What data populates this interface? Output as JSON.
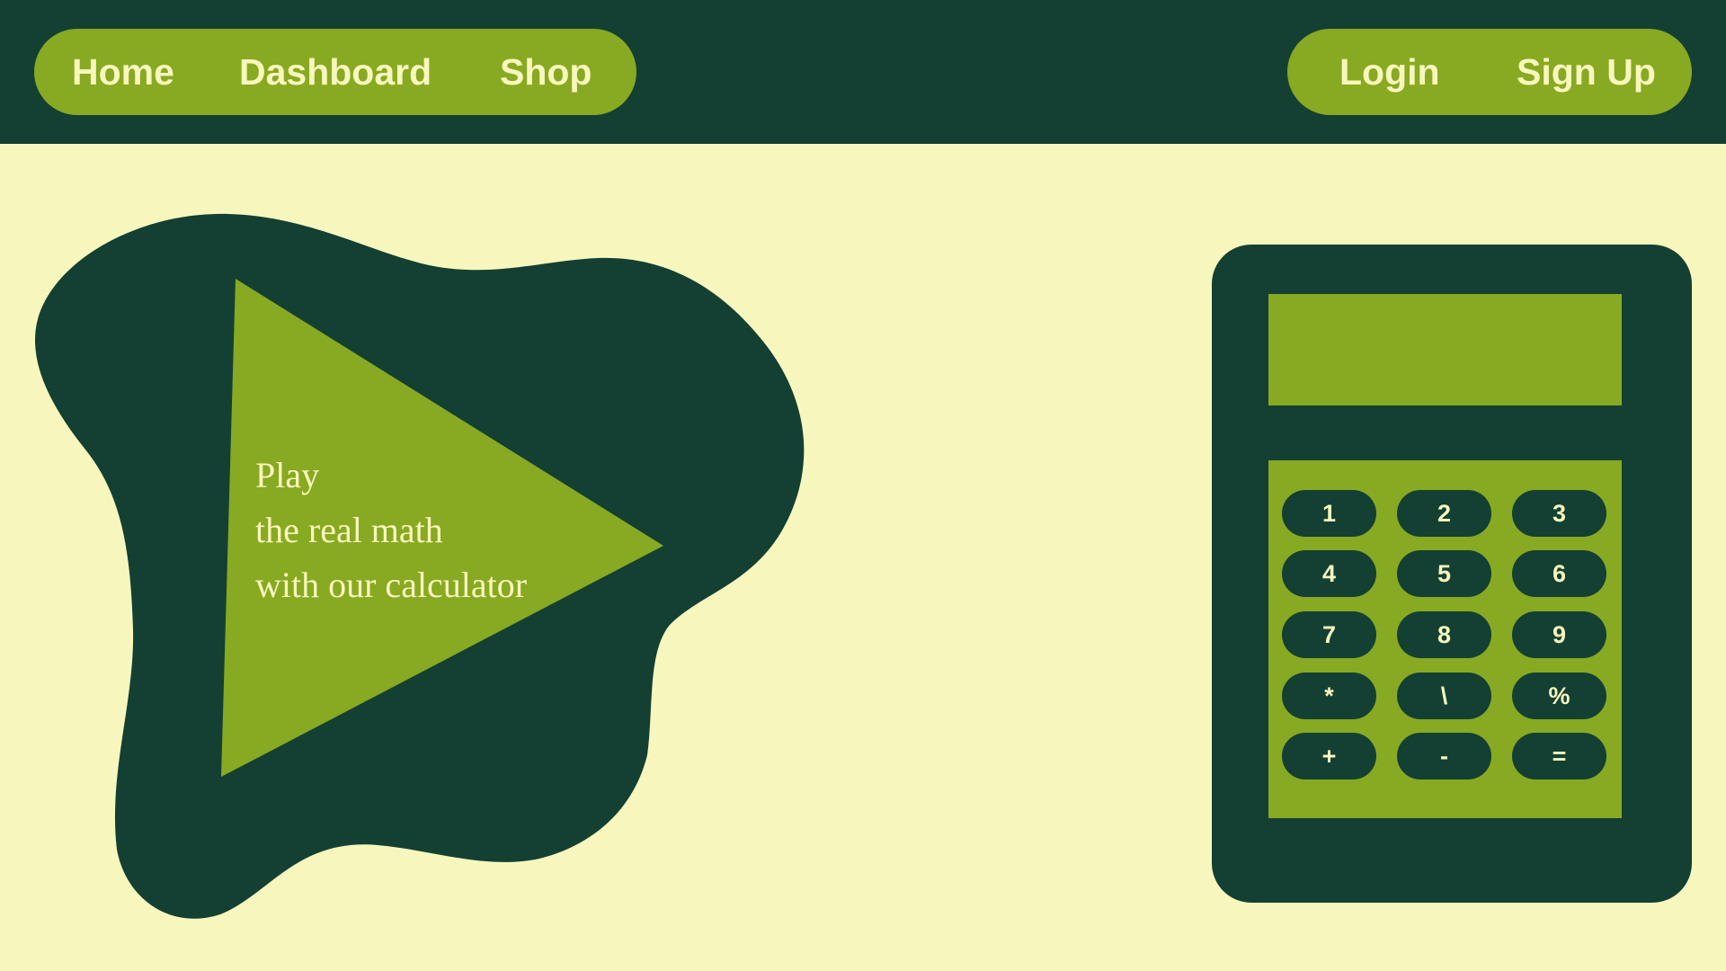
{
  "nav": {
    "left": [
      "Home",
      "Dashboard",
      "Shop"
    ],
    "right": [
      "Login",
      "Sign Up"
    ]
  },
  "hero": {
    "lines": [
      "Play",
      "the real math",
      "with our calculator"
    ]
  },
  "calculator": {
    "display_value": "",
    "keys": [
      "1",
      "2",
      "3",
      "4",
      "5",
      "6",
      "7",
      "8",
      "9",
      "*",
      "\\",
      "%",
      "+",
      "-",
      "="
    ]
  },
  "colors": {
    "dark_green": "#134033",
    "accent_green": "#88a922",
    "background": "#f7f7bd",
    "text_light": "#f7f7bd"
  }
}
